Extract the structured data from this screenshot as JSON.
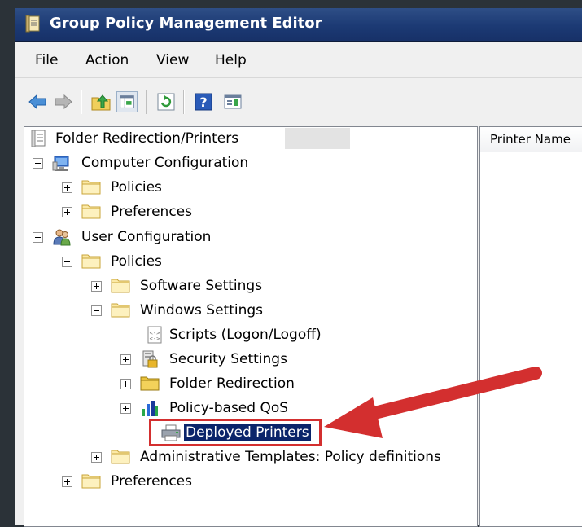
{
  "window": {
    "title": "Group Policy Management Editor"
  },
  "menu": [
    {
      "label": "File"
    },
    {
      "label": "Action"
    },
    {
      "label": "View"
    },
    {
      "label": "Help"
    }
  ],
  "toolbar": {
    "icons": [
      "back-arrow-icon",
      "forward-arrow-icon",
      "up-folder-icon",
      "show-hide-tree-icon",
      "refresh-icon",
      "help-icon",
      "properties-icon"
    ]
  },
  "tree": {
    "root": "Folder Redirection/Printers",
    "computer_configuration": "Computer Configuration",
    "cc_policies": "Policies",
    "cc_preferences": "Preferences",
    "user_configuration": "User Configuration",
    "uc_policies": "Policies",
    "software_settings": "Software Settings",
    "windows_settings": "Windows Settings",
    "scripts": "Scripts (Logon/Logoff)",
    "security_settings": "Security Settings",
    "folder_redirection": "Folder Redirection",
    "qos": "Policy-based QoS",
    "deployed_printers": "Deployed Printers",
    "admin_templates": "Administrative Templates: Policy definitions",
    "uc_preferences": "Preferences"
  },
  "right_pane": {
    "column_header": "Printer Name"
  },
  "colors": {
    "title_bar": "#1c3a74",
    "selection": "#0a246a",
    "highlight_arrow": "#d32f2f"
  }
}
